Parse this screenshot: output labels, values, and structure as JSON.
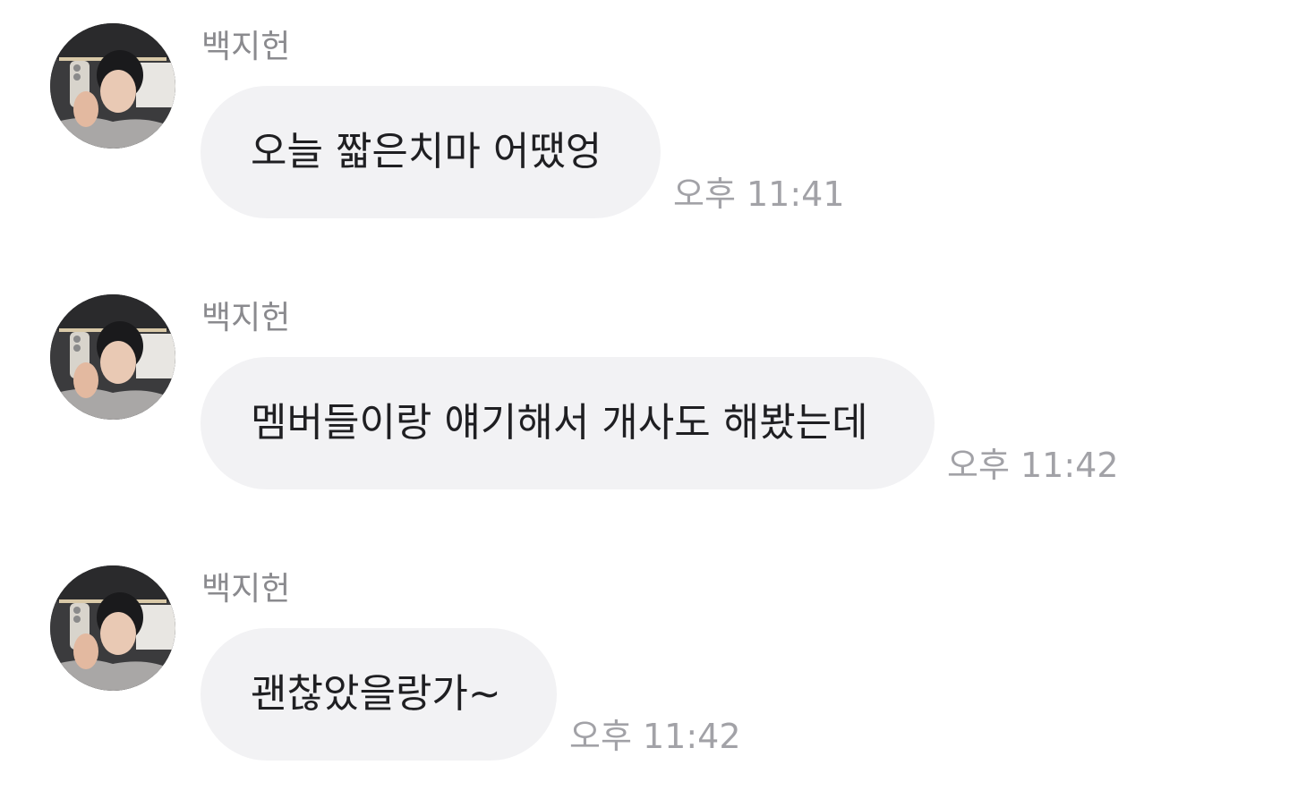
{
  "messages": [
    {
      "sender": "백지헌",
      "text": "오늘 짧은치마 어땠엉",
      "time": "오후 11:41"
    },
    {
      "sender": "백지헌",
      "text": "멤버들이랑 얘기해서 개사도 해봤는데",
      "time": "오후 11:42"
    },
    {
      "sender": "백지헌",
      "text": "괜찮았을랑가~",
      "time": "오후 11:42"
    }
  ],
  "colors": {
    "bubble_bg": "#f2f2f4",
    "sender_text": "#8a8a8e",
    "time_text": "#a2a2a7",
    "message_text": "#1f1f22"
  }
}
